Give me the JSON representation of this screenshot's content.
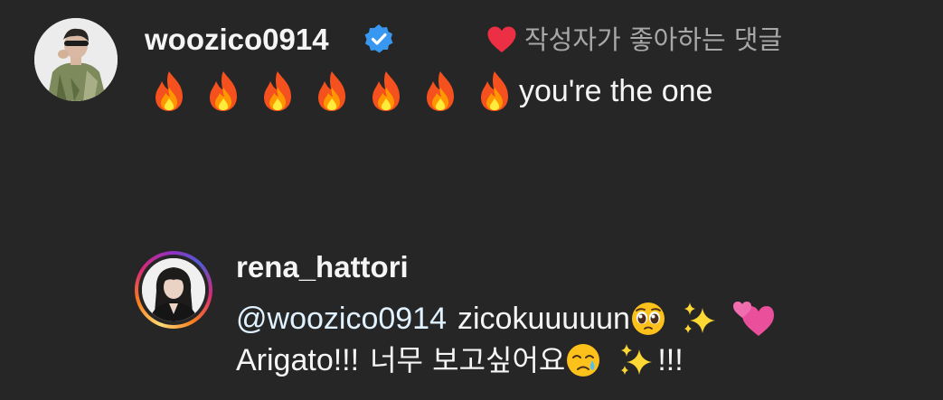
{
  "comment": {
    "username": "woozico0914",
    "verified_icon": "verified-badge-icon",
    "liked_by_author": {
      "icon": "heart-icon",
      "color": "#ed2f45",
      "text": "작성자가 좋아하는 댓글"
    },
    "emojis": [
      "fire",
      "fire",
      "fire",
      "fire",
      "fire",
      "fire",
      "fire"
    ],
    "text": "you're the one"
  },
  "reply": {
    "username": "rena_hattori",
    "line1": {
      "mention": "@woozico0914",
      "text": "zicokuuuuun",
      "emojis": [
        "pleading-face",
        "sparkles",
        "two-hearts"
      ]
    },
    "line2": {
      "text_a": "Arigato!!!",
      "text_b": "너무 보고싶어요",
      "emojis": [
        "crying-face",
        "sparkles"
      ],
      "text_c": "!!!"
    }
  },
  "colors": {
    "background": "#262626",
    "text": "#f5f5f5",
    "secondary_text": "#a8a8a8",
    "verified": "#3897f0",
    "mention": "#e0f1ff"
  }
}
